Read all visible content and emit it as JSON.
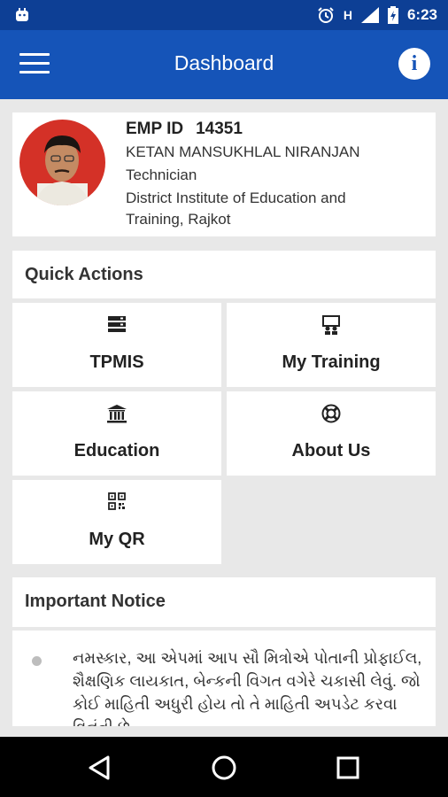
{
  "status_bar": {
    "time": "6:23",
    "network": "H"
  },
  "app_bar": {
    "title": "Dashboard",
    "info_label": "i"
  },
  "profile": {
    "emp_label": "EMP ID",
    "emp_id": "14351",
    "name": "KETAN MANSUKHLAL NIRANJAN",
    "designation": "Technician",
    "institute_line1": "District Institute of Education and",
    "institute_line2": "Training, Rajkot"
  },
  "quick_actions": {
    "title": "Quick Actions",
    "items": [
      {
        "label": "TPMIS",
        "icon": "server-icon"
      },
      {
        "label": "My Training",
        "icon": "presentation-icon"
      },
      {
        "label": "Education",
        "icon": "institution-icon"
      },
      {
        "label": "About Us",
        "icon": "lifebuoy-icon"
      },
      {
        "label": "My QR",
        "icon": "qrcode-icon"
      }
    ]
  },
  "notice": {
    "title": "Important Notice",
    "text": "નમસ્કાર, આ એપમાં આપ સૌ મિત્રોએ પોતાની પ્રોફાઈલ, શૈક્ષણિક લાયકાત, બેન્કની વિગત વગેરે ચકાસી લેવું. જો કોઈ માહિતી અધુરી હોય તો તે માહિતી અપડેટ કરવા વિનંતી છે."
  },
  "colors": {
    "status_bar": "#0d3f95",
    "app_bar": "#1554b8",
    "avatar_bg": "#d43127"
  }
}
